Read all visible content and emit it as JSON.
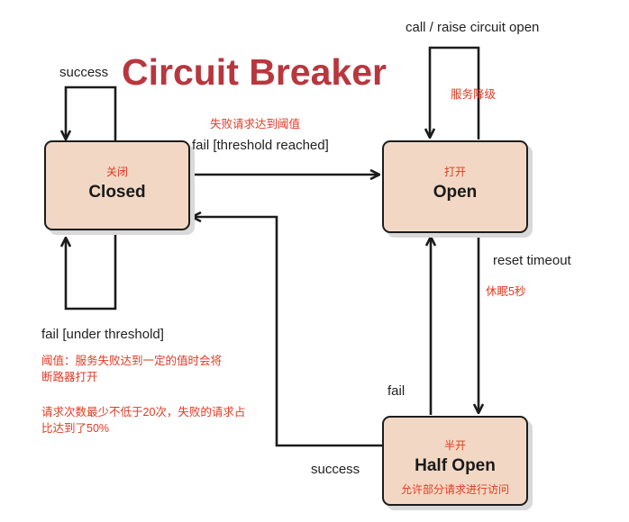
{
  "title": "Circuit Breaker",
  "states": {
    "closed": {
      "cn": "关闭",
      "en": "Closed"
    },
    "open": {
      "cn": "打开",
      "en": "Open"
    },
    "halfopen": {
      "cn": "半开",
      "en": "Half Open",
      "note": "允许部分请求进行访问"
    }
  },
  "edges": {
    "closed_success": "success",
    "closed_fail_under": "fail [under threshold]",
    "closed_to_open": "fail [threshold reached]",
    "closed_to_open_cn": "失败请求达到阈值",
    "open_self": "call / raise circuit open",
    "open_self_cn": "服务降级",
    "open_to_half": "reset timeout",
    "open_to_half_cn": "休眠5秒",
    "half_to_open": "fail",
    "half_to_closed": "success"
  },
  "notes": {
    "threshold_line1": "阈值：服务失败达到一定的值时会将",
    "threshold_line2": "断路器打开",
    "rule_line1": "请求次数最少不低于20次，失败的请求占",
    "rule_line2": "比达到了50%"
  },
  "colors": {
    "state_fill": "#f2d8c4",
    "title": "#b8373f",
    "annotation": "#e03b24",
    "line": "#1c1c1c"
  }
}
